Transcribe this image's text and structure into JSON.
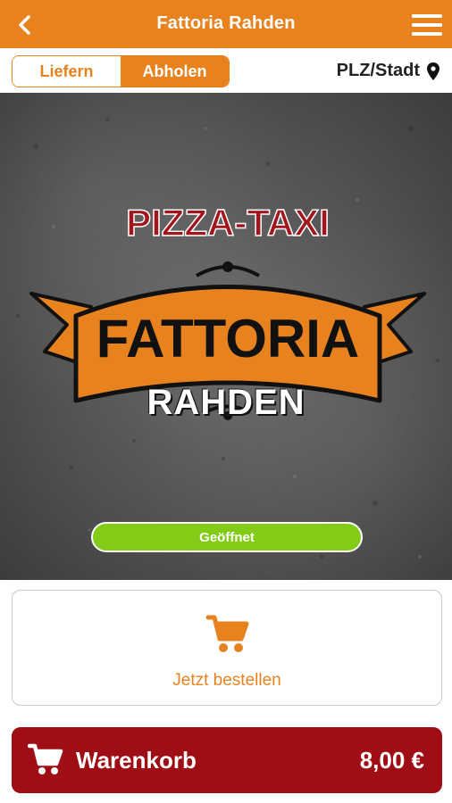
{
  "header": {
    "title": "Fattoria Rahden",
    "back_icon": "chevron-left-icon",
    "menu_icon": "hamburger-menu-icon"
  },
  "mode_toggle": {
    "options": [
      {
        "label": "Liefern",
        "active": false
      },
      {
        "label": "Abholen",
        "active": true
      }
    ]
  },
  "location": {
    "label": "PLZ/Stadt",
    "icon": "map-pin-icon"
  },
  "hero": {
    "logo_text": {
      "top": "PIZZA-TAXI",
      "middle": "FATTORIA",
      "bottom": "RAHDEN"
    },
    "status": "Geöffnet"
  },
  "order_card": {
    "label": "Jetzt bestellen",
    "icon": "shopping-cart-icon"
  },
  "cart": {
    "label": "Warenkorb",
    "total": "8,00 €",
    "icon": "shopping-cart-icon"
  },
  "colors": {
    "accent": "#e8821f",
    "status_green": "#82cc18",
    "cart_red": "#9e0e14",
    "logo_red": "#a3151c"
  }
}
